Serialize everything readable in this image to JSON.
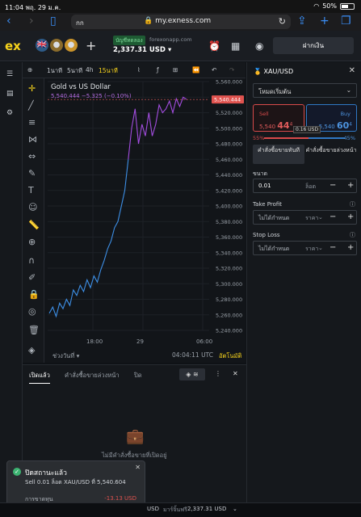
{
  "status_bar": {
    "time": "11:04",
    "date": "พฤ. 29 ม.ค.",
    "battery": "50%"
  },
  "browser": {
    "reader_label": "กก",
    "url": "my.exness.com"
  },
  "header": {
    "logo": "ex",
    "account_type": "บัญชีทดลอง",
    "account_server": "forexonapp.com",
    "balance": "2,337.31 USD",
    "deposit_label": "ฝากเงิน"
  },
  "chart_toolbar": {
    "timeframes": [
      "1นาที",
      "5นาที",
      "4h",
      "15นาที"
    ],
    "active_timeframe": "15นาที"
  },
  "chart": {
    "title": "Gold vs US Dollar",
    "quote": "5,540.444 −5.325 (−0.10%)",
    "current_price_label": "5,540.444",
    "price_axis": [
      "5,560.000",
      "5,540.000",
      "5,520.000",
      "5,500.000",
      "5,480.000",
      "5,460.000",
      "5,440.000",
      "5,420.000",
      "5,400.000",
      "5,380.000",
      "5,360.000",
      "5,340.000",
      "5,320.000",
      "5,300.000",
      "5,280.000",
      "5,260.000",
      "5,240.000"
    ],
    "time_axis": [
      "18:00",
      "29",
      "06:00"
    ],
    "period_label": "ช่วงวันที่",
    "clock": "04:04:11 UTC",
    "auto_label": "อัตโนมัติ"
  },
  "chart_data": {
    "type": "line",
    "title": "Gold vs US Dollar",
    "ylim": [
      5240,
      5560
    ],
    "series": [
      {
        "values": [
          5262,
          5270,
          5258,
          5275,
          5268,
          5280,
          5272,
          5292,
          5285,
          5298,
          5290,
          5305,
          5295,
          5310,
          5302,
          5318,
          5330,
          5345,
          5355,
          5372,
          5380,
          5400,
          5420,
          5460,
          5500,
          5525,
          5480,
          5505,
          5490,
          5520,
          5490,
          5505,
          5530,
          5520,
          5525,
          5535,
          5520,
          5538,
          5528,
          5540,
          5537
        ]
      }
    ]
  },
  "right_panel": {
    "symbol": "XAU/USD",
    "mode": "โหมดเริ่มต้น",
    "sell_label": "Sell",
    "sell_price": "5,540",
    "sell_big": "44",
    "sell_sup": "4",
    "buy_label": "Buy",
    "buy_price": "5,540",
    "buy_big": "60",
    "buy_sup": "4",
    "spread": "0.16 USD",
    "sell_percent": "55%",
    "buy_percent": "45%",
    "market_order": "คำสั่งซื้อขายทันที",
    "pending_order": "คำสั่งซื้อขายล่วงหน้า",
    "volume_label": "ขนาด",
    "volume_value": "0.01",
    "volume_unit": "ล็อต",
    "tp_label": "Take Profit",
    "tp_value": "ไม่ได้กำหนด",
    "tp_unit": "ราคา",
    "sl_label": "Stop Loss",
    "sl_value": "ไม่ได้กำหนด",
    "sl_unit": "ราคา"
  },
  "bottom_panel": {
    "tabs": [
      "เปิดแล้ว",
      "คำสั่งซื้อขายล่วงหน้า",
      "ปิด"
    ],
    "empty_text": "ไม่มีคำสั่งซื้อขายที่เปิดอยู่"
  },
  "toast": {
    "title": "ปิดสถานะแล้ว",
    "detail": "Sell 0.01 ล็อต XAU/USD ที่ 5,540.604",
    "pl_label": "การขาดทุน",
    "pl_value": "-13.13 USD"
  },
  "footer": {
    "currency": "USD",
    "margin_label": "มาร์จิ้นฟรี",
    "margin_value": "2,337.31 USD"
  }
}
